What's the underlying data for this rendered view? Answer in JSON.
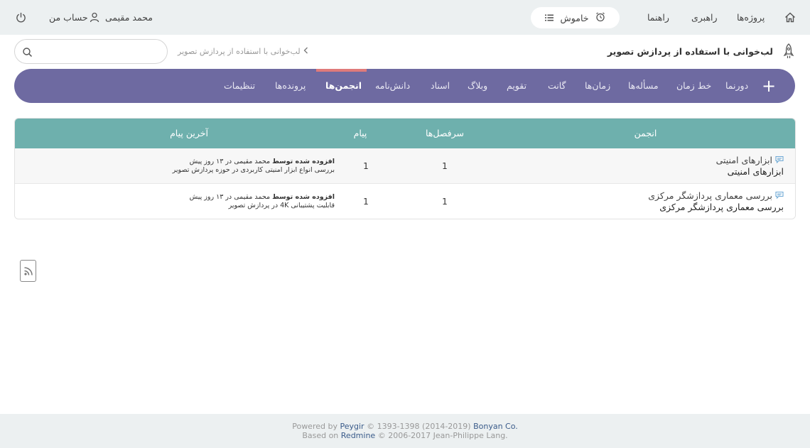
{
  "topbar": {
    "home_icon": "home-icon",
    "projects_label": "پروژه‌ها",
    "admin_label": "راهبری",
    "help_label": "راهنما",
    "timer_label": "خاموش",
    "user_name": "محمد مقیمی",
    "my_account_label": "حساب من"
  },
  "header": {
    "project_title": "لب‌خوانی با استفاده از پردازش تصویر",
    "breadcrumb": "لب‌خوانی با استفاده از پردازش تصویر",
    "search_placeholder": ""
  },
  "nav": {
    "items": [
      {
        "label": "دورنما"
      },
      {
        "label": "خط زمان"
      },
      {
        "label": "مسأله‌ها"
      },
      {
        "label": "زمان‌ها"
      },
      {
        "label": "گانت"
      },
      {
        "label": "تقویم"
      },
      {
        "label": "وبلاگ"
      },
      {
        "label": "اسناد"
      },
      {
        "label": "دانش‌نامه"
      },
      {
        "label": "انجمن‌ها"
      },
      {
        "label": "پرونده‌ها"
      },
      {
        "label": "تنظیمات"
      }
    ],
    "active_index": 9,
    "active_color": "#e07a7a",
    "bar_color": "#6e6aa1"
  },
  "table": {
    "headers": {
      "forum": "انجمن",
      "topics": "سرفصل‌ها",
      "messages": "پیام",
      "last_message": "آخرین پیام"
    },
    "header_color": "#6eb0ad",
    "rows": [
      {
        "forum_name": "ابزارهای امنیتی",
        "forum_desc": "ابزارهای امنیتی",
        "topics": "1",
        "messages": "1",
        "last_added": "افزوده شده توسط",
        "last_user": "محمد مقیمی",
        "last_when": "در ۱۳ روز پیش",
        "last_subject": "بررسی انواع ابزار امنیتی کاربردی در حوزه پردازش تصویر"
      },
      {
        "forum_name": "بررسی معماری پردازشگر مرکزی",
        "forum_desc": "بررسی معماری پردازشگر مرکزی",
        "topics": "1",
        "messages": "1",
        "last_added": "افزوده شده توسط",
        "last_user": "محمد مقیمی",
        "last_when": "در ۱۳ روز پیش",
        "last_subject": "قابلیت پشتیبانی 4K در پردازش تصویر"
      }
    ]
  },
  "footer": {
    "powered_by": "Powered by",
    "peygir": "Peygir",
    "copy1": "© 1393-1398 (2014-2019)",
    "bonyan": "Bonyan Co.",
    "based_on": "Based on",
    "redmine": "Redmine",
    "copy2": "© 2006-2017 Jean-Philippe Lang."
  }
}
